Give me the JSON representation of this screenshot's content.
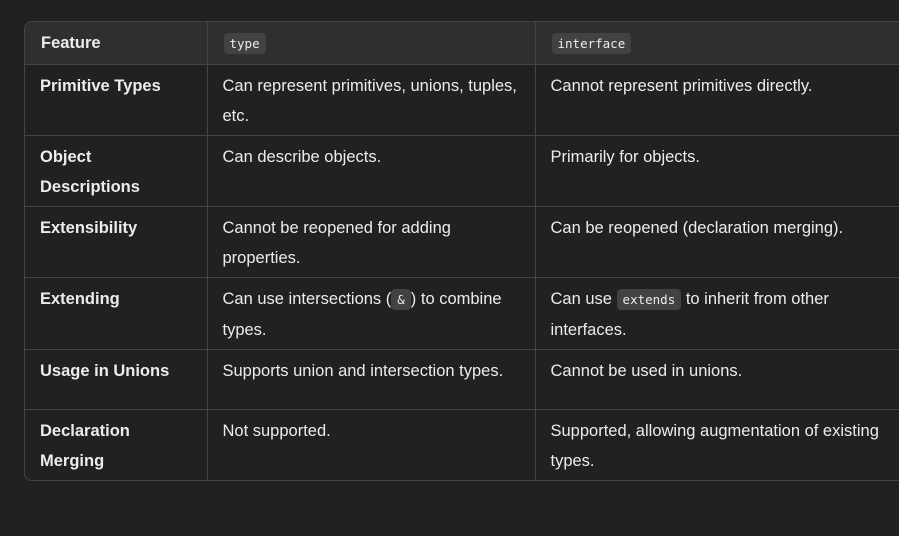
{
  "table": {
    "headers": {
      "feature": "Feature",
      "type": "type",
      "interface": "interface"
    },
    "rows": [
      {
        "feature": "Primitive Types",
        "type": "Can represent primitives, unions, tuples, etc.",
        "interface": "Cannot represent primitives directly."
      },
      {
        "feature": "Object Descriptions",
        "type": "Can describe objects.",
        "interface": "Primarily for objects."
      },
      {
        "feature": "Extensibility",
        "type": "Cannot be reopened for adding properties.",
        "interface": "Can be reopened (declaration merging)."
      },
      {
        "feature": "Extending",
        "type_before": "Can use intersections (",
        "type_code": "&",
        "type_after": ") to combine types.",
        "interface_before": "Can use ",
        "interface_code": "extends",
        "interface_after": " to inherit from other interfaces."
      },
      {
        "feature": "Usage in Unions",
        "type": "Supports union and intersection types.",
        "interface": "Cannot be used in unions."
      },
      {
        "feature": "Declaration Merging",
        "type": "Not supported.",
        "interface": "Supported, allowing augmentation of existing types."
      }
    ]
  }
}
